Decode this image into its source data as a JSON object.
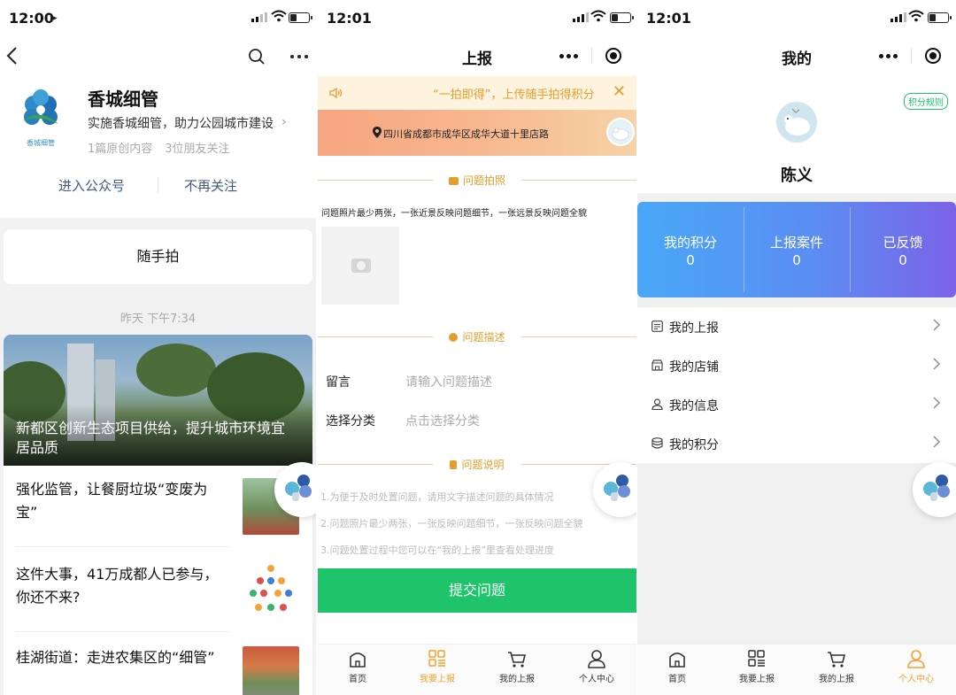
{
  "panel1": {
    "status_time": "12:00",
    "account": {
      "name": "香城细管",
      "logo_text": "香城细管",
      "description": "实施香城细管，助力公园城市建设",
      "original_count": "1篇原创内容",
      "followers": "3位朋友关注"
    },
    "actions": {
      "enter": "进入公众号",
      "unfollow": "不再关注"
    },
    "menu_label": "随手拍",
    "message_time": "昨天 下午7:34",
    "cover_title": "新都区创新生态项目供给，提升城市环境宜居品质",
    "articles": [
      {
        "title": "强化监管，让餐厨垃圾“变废为宝”"
      },
      {
        "title": "这件大事，41万成都人已参与，你还不来?"
      },
      {
        "title": "桂湖街道：走进农集区的“细管”"
      }
    ]
  },
  "panel2": {
    "status_time": "12:01",
    "title": "上报",
    "notice": "“一拍即得”，上传随手拍得积分",
    "address": "四川省成都市成华区成华大道十里店路",
    "photo_section": "问题拍照",
    "photo_hint": "问题照片最少两张，一张近景反映问题细节，一张远景反映问题全貌",
    "desc_section": "问题描述",
    "form": [
      {
        "label": "留言",
        "placeholder": "请输入问题描述"
      },
      {
        "label": "选择分类",
        "placeholder": "点击选择分类"
      }
    ],
    "notes_section": "问题说明",
    "notes": [
      "1.为便于及时处置问题，请用文字描述问题的具体情况",
      "2.问题照片最少两张，一张反映问题细节，一张反映问题全貌",
      "3.问题处置过程中您可以在“我的上报”里查看处理进度"
    ],
    "submit": "提交问题"
  },
  "panel3": {
    "status_time": "12:01",
    "title": "我的",
    "rules": "积分规则",
    "user_name": "陈义",
    "stats": [
      {
        "label": "我的积分",
        "value": "0"
      },
      {
        "label": "上报案件",
        "value": "0"
      },
      {
        "label": "已反馈",
        "value": "0"
      }
    ],
    "menu": [
      {
        "label": "我的上报",
        "icon": "report-list-icon"
      },
      {
        "label": "我的店铺",
        "icon": "store-icon"
      },
      {
        "label": "我的信息",
        "icon": "user-icon"
      },
      {
        "label": "我的积分",
        "icon": "coins-icon"
      }
    ]
  },
  "tabbar": {
    "items": [
      "首页",
      "我要上报",
      "我的上报",
      "个人中心"
    ],
    "panel2_active": 1,
    "panel3_active": 3,
    "active_color": "#f3a12f"
  },
  "colors": {
    "accent_green": "#1ec36a",
    "accent_orange": "#e59d2e",
    "link_blue": "#3d5a80"
  }
}
